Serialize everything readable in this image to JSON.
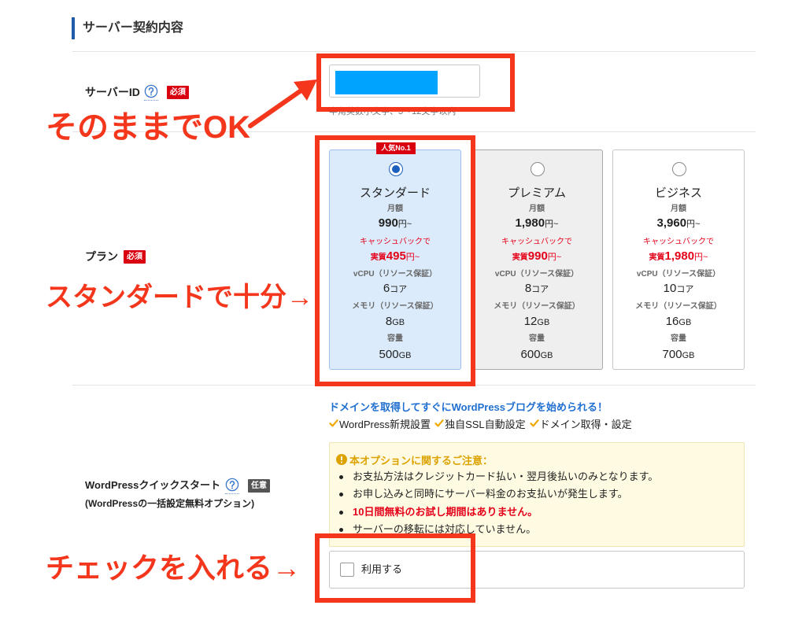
{
  "colors": {
    "annotation_red": "#f4361c",
    "heading_bar": "#1f5ba8",
    "required_badge": "#d9000f",
    "optional_badge": "#555555",
    "price_red": "#e5001a",
    "headline_blue": "#1f6fd1",
    "notice_gold": "#dca200",
    "notice_bg": "#fffbe3",
    "check_gold": "#f0a800",
    "redaction": "#00a4ff",
    "selected_radio": "#1b5fbf",
    "standard_card_bg": "#dcebfb",
    "premium_card_bg": "#efefef"
  },
  "section": {
    "title": "サーバー契約内容"
  },
  "server_id": {
    "label": "サーバーID",
    "help_icon": "question-circle-icon",
    "required_badge": "必須",
    "hint": "半角英数小文字、3～12文字以内"
  },
  "plan": {
    "label": "プラン",
    "required_badge": "必須",
    "popular_badge": "人気No.1",
    "options": [
      {
        "name": "スタンダード",
        "selected": true,
        "monthly_label": "月額",
        "price": "990",
        "price_unit": "円~",
        "cashback_label": "キャッシュバックで",
        "effective_label": "実質",
        "effective_price": "495",
        "effective_unit": "円~",
        "vcpu_label": "vCPU（リソース保証）",
        "vcpu": "6",
        "vcpu_unit": "コア",
        "memory_label": "メモリ（リソース保証）",
        "memory": "8",
        "memory_unit": "GB",
        "storage_label": "容量",
        "storage": "500",
        "storage_unit": "GB"
      },
      {
        "name": "プレミアム",
        "selected": false,
        "monthly_label": "月額",
        "price": "1,980",
        "price_unit": "円~",
        "cashback_label": "キャッシュバックで",
        "effective_label": "実質",
        "effective_price": "990",
        "effective_unit": "円~",
        "vcpu_label": "vCPU（リソース保証）",
        "vcpu": "8",
        "vcpu_unit": "コア",
        "memory_label": "メモリ（リソース保証）",
        "memory": "12",
        "memory_unit": "GB",
        "storage_label": "容量",
        "storage": "600",
        "storage_unit": "GB"
      },
      {
        "name": "ビジネス",
        "selected": false,
        "monthly_label": "月額",
        "price": "3,960",
        "price_unit": "円~",
        "cashback_label": "キャッシュバックで",
        "effective_label": "実質",
        "effective_price": "1,980",
        "effective_unit": "円~",
        "vcpu_label": "vCPU（リソース保証）",
        "vcpu": "10",
        "vcpu_unit": "コア",
        "memory_label": "メモリ（リソース保証）",
        "memory": "16",
        "memory_unit": "GB",
        "storage_label": "容量",
        "storage": "700",
        "storage_unit": "GB"
      }
    ]
  },
  "wordpress": {
    "headline": "ドメインを取得してすぐにWordPressブログを始められる！",
    "feature_icon": "check-icon",
    "features": [
      "WordPress新規設置",
      "独自SSL自動設定",
      "ドメイン取得・設定"
    ],
    "notice_icon": "warning-circle-icon",
    "notice_title": "本オプションに関するご注意：",
    "notice_items": [
      {
        "text": "お支払方法はクレジットカード払い・翌月後払いのみとなります。",
        "emphasis": false
      },
      {
        "text": "お申し込みと同時にサーバー料金のお支払いが発生します。",
        "emphasis": false
      },
      {
        "text": "10日間無料のお試し期間はありません。",
        "emphasis": true
      },
      {
        "text": "サーバーの移転には対応していません。",
        "emphasis": false
      }
    ],
    "label": "WordPressクイックスタート",
    "help_icon": "question-circle-icon",
    "optional_badge": "任意",
    "sublabel": "(WordPressの一括設定無料オプション)",
    "checkbox_label": "利用する",
    "checked": false
  },
  "annotations": {
    "server_id_note": "そのままでOK",
    "arrow_icon": "arrow-up-right-icon",
    "plan_note": "スタンダードで十分→",
    "wordpress_note": "チェックを入れる→"
  }
}
